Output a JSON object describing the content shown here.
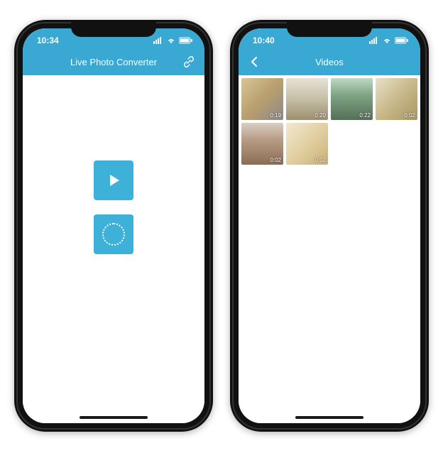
{
  "colors": {
    "accent": "#39a9d4",
    "button": "#3eb1d8"
  },
  "phoneLeft": {
    "status": {
      "time": "10:34"
    },
    "navbar": {
      "title": "Live Photo Converter"
    },
    "buttons": {
      "play": {
        "name": "play-button"
      },
      "live": {
        "name": "live-photo-button"
      }
    }
  },
  "phoneRight": {
    "status": {
      "time": "10:40"
    },
    "navbar": {
      "title": "Videos",
      "back": "back"
    },
    "videos": [
      {
        "duration": "0:19"
      },
      {
        "duration": "0:20"
      },
      {
        "duration": "0:22"
      },
      {
        "duration": "0:02"
      },
      {
        "duration": "0:02"
      },
      {
        "duration": "0:02"
      }
    ]
  }
}
